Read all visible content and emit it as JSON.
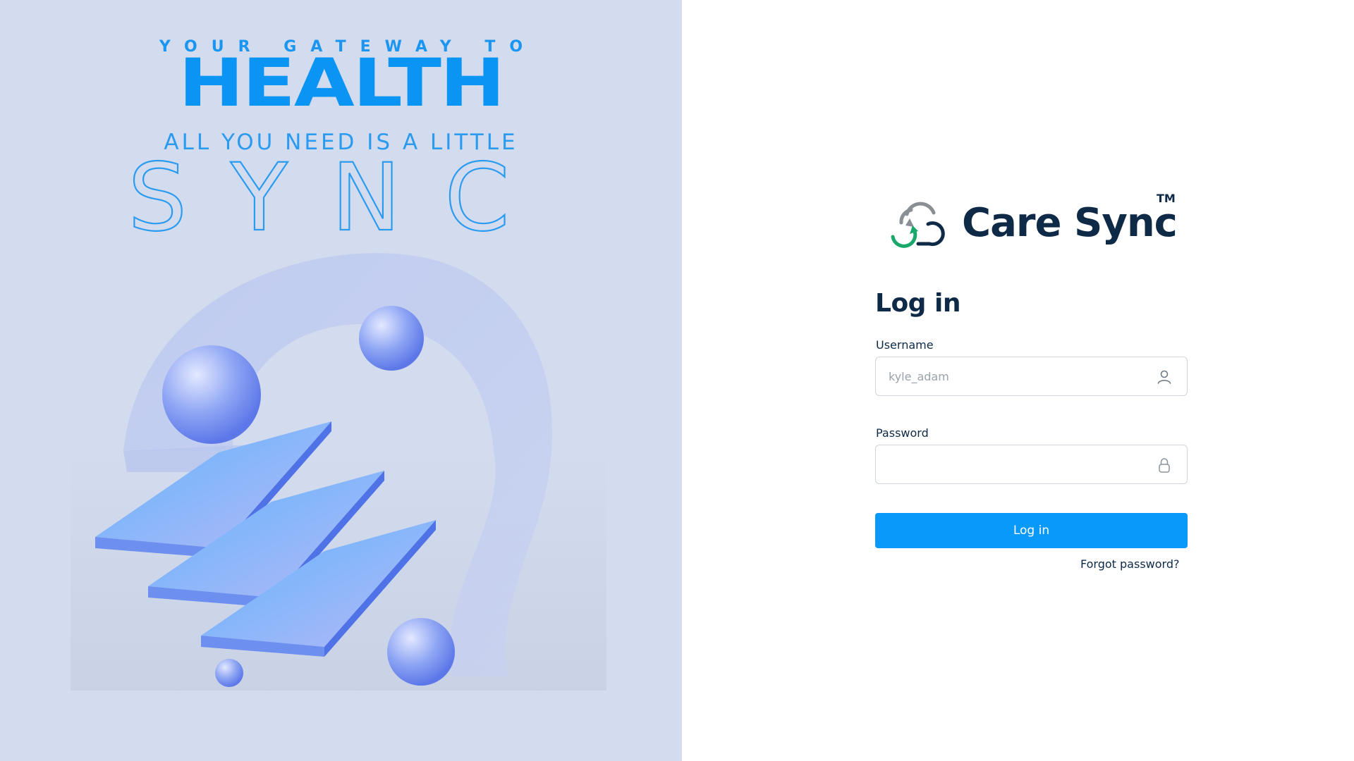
{
  "hero": {
    "tagline": "YOUR GATEWAY TO",
    "headline": "HEALTH",
    "subline": "ALL YOU NEED IS  A LITTLE",
    "outline_word": "SYNC",
    "colors": {
      "background": "#d3dbee",
      "accent": "#0a95f5"
    }
  },
  "brand": {
    "name": "Care Sync",
    "trademark": "TM",
    "logo_icon": "cloud-sync-icon",
    "colors": {
      "text": "#0e2a47",
      "arrow_gray": "#8a8f95",
      "arrow_green": "#1aa86a"
    }
  },
  "login": {
    "title": "Log in",
    "username": {
      "label": "Username",
      "placeholder": "kyle_adam",
      "value": "",
      "icon": "user-icon"
    },
    "password": {
      "label": "Password",
      "placeholder": "",
      "value": "",
      "icon": "lock-icon"
    },
    "submit_label": "Log in",
    "forgot_label": "Forgot password?",
    "colors": {
      "button": "#0899fb",
      "input_border": "#cfd5db"
    }
  }
}
